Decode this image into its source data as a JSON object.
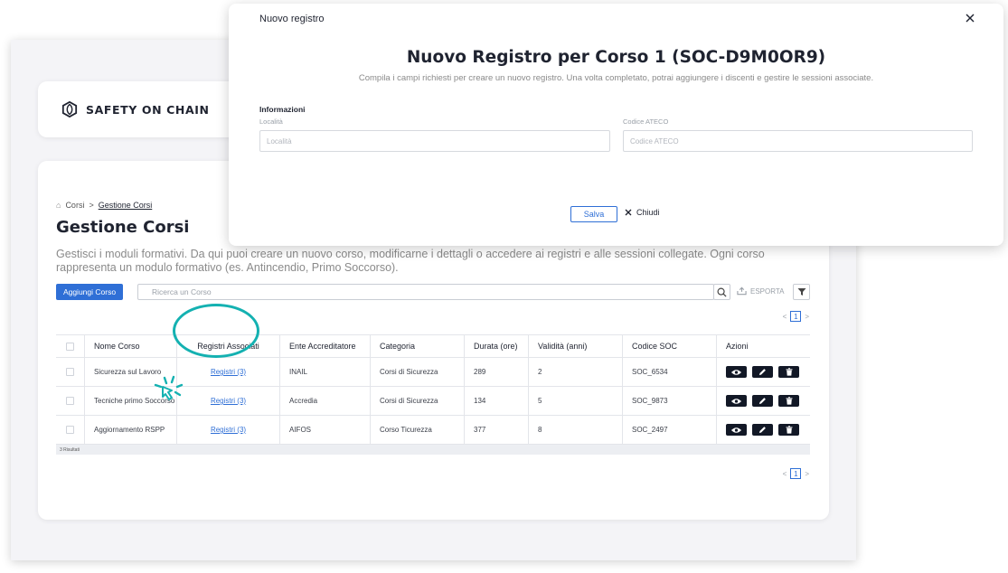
{
  "modal": {
    "header": "Nuovo registro",
    "title": "Nuovo Registro per Corso 1 (SOC-D9M0OR9)",
    "subtitle": "Compila i campi richiesti per creare un nuovo registro. Una volta completato, potrai aggiungere i discenti e gestire le sessioni associate.",
    "section": "Informazioni",
    "fields": [
      {
        "label": "Località",
        "placeholder": "Località"
      },
      {
        "label": "Codice ATECO",
        "placeholder": "Codice ATECO"
      }
    ],
    "save_label": "Salva",
    "close_label": "Chiudi"
  },
  "brand": {
    "name": "SAFETY ON CHAIN"
  },
  "breadcrumb": {
    "root": "Corsi",
    "separator": ">",
    "current": "Gestione Corsi"
  },
  "page": {
    "title": "Gestione Corsi",
    "description": "Gestisci i moduli formativi. Da qui puoi creare un nuovo corso, modificarne i dettagli o accedere ai registri e alle sessioni collegate. Ogni corso rappresenta un modulo formativo (es. Antincendio, Primo Soccorso)."
  },
  "toolbar": {
    "add_label": "Aggiungi Corso",
    "search_placeholder": "Ricerca un Corso",
    "export_label": "ESPORTA"
  },
  "pagination": {
    "prev": "<",
    "current": "1",
    "next": ">"
  },
  "table": {
    "columns": [
      "Nome Corso",
      "Registri Associati",
      "Ente Accreditatore",
      "Categoria",
      "Durata (ore)",
      "Validità (anni)",
      "Codice SOC",
      "Azioni"
    ],
    "rows": [
      {
        "name": "Sicurezza sul Lavoro",
        "registri": "Registri (3)",
        "ente": "INAIL",
        "categoria": "Corsi di Sicurezza",
        "durata": "289",
        "validita": "2",
        "codice": "SOC_6534"
      },
      {
        "name": "Tecniche primo Soccorso",
        "registri": "Registri (3)",
        "ente": "Accredia",
        "categoria": "Corsi di Sicurezza",
        "durata": "134",
        "validita": "5",
        "codice": "SOC_9873"
      },
      {
        "name": "Aggiornamento RSPP",
        "registri": "Registri (3)",
        "ente": "AIFOS",
        "categoria": "Corso Ticurezza",
        "durata": "377",
        "validita": "8",
        "codice": "SOC_2497"
      }
    ],
    "footer": "3 Risultati"
  },
  "icons": {
    "view": "eye-icon",
    "edit": "pencil-icon",
    "delete": "trash-icon",
    "search": "search-icon",
    "export": "export-icon",
    "filter": "filter-icon",
    "close": "close-icon",
    "home": "home-icon",
    "logo": "logo-icon",
    "click": "click-burst-icon"
  },
  "colors": {
    "primary": "#2f6fd6",
    "highlight": "#14b1b1",
    "action": "#121826"
  }
}
